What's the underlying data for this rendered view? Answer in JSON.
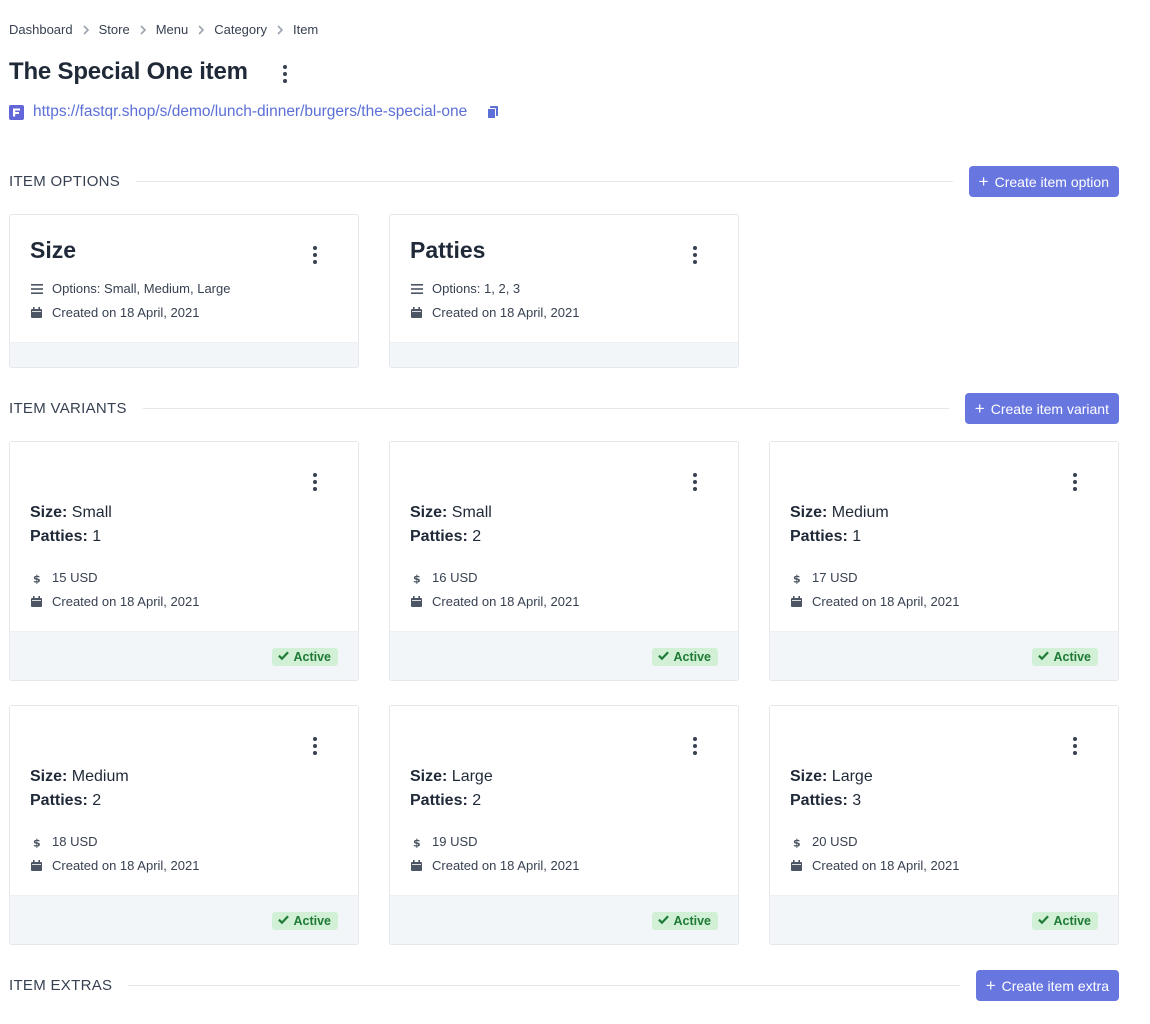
{
  "breadcrumb": [
    "Dashboard",
    "Store",
    "Menu",
    "Category",
    "Item"
  ],
  "page": {
    "title": "The Special One item",
    "url": "https://fastqr.shop/s/demo/lunch-dinner/burgers/the-special-one"
  },
  "options_section": {
    "title": "ITEM OPTIONS",
    "button_label": "Create item option",
    "cards": [
      {
        "title": "Size",
        "options": "Options: Small, Medium, Large",
        "created": "Created on 18 April, 2021"
      },
      {
        "title": "Patties",
        "options": "Options: 1, 2, 3",
        "created": "Created on 18 April, 2021"
      }
    ]
  },
  "variants_section": {
    "title": "ITEM VARIANTS",
    "button_label": "Create item variant",
    "size_label": "Size:",
    "patties_label": "Patties:",
    "cards": [
      {
        "size": "Small",
        "patties": "1",
        "price": "15 USD",
        "created": "Created on 18 April, 2021",
        "status": "Active"
      },
      {
        "size": "Small",
        "patties": "2",
        "price": "16 USD",
        "created": "Created on 18 April, 2021",
        "status": "Active"
      },
      {
        "size": "Medium",
        "patties": "1",
        "price": "17 USD",
        "created": "Created on 18 April, 2021",
        "status": "Active"
      },
      {
        "size": "Medium",
        "patties": "2",
        "price": "18 USD",
        "created": "Created on 18 April, 2021",
        "status": "Active"
      },
      {
        "size": "Large",
        "patties": "2",
        "price": "19 USD",
        "created": "Created on 18 April, 2021",
        "status": "Active"
      },
      {
        "size": "Large",
        "patties": "3",
        "price": "20 USD",
        "created": "Created on 18 April, 2021",
        "status": "Active"
      }
    ]
  },
  "extras_section": {
    "title": "ITEM EXTRAS",
    "button_label": "Create item extra"
  },
  "colors": {
    "accent": "#6876e0",
    "link": "#5b6fd6",
    "active_badge_bg": "#d1f0d6",
    "active_badge_text": "#1f7a36",
    "card_footer": "#f3f6f9"
  },
  "icons": {
    "breadcrumb_separator": "chevron-right-icon",
    "title_menu": "more-vertical-icon",
    "brand": "fastqr-logo-icon",
    "copy": "copy-icon",
    "options": "list-icon",
    "created": "calendar-icon",
    "price": "dollar-icon",
    "active": "check-icon",
    "add": "plus-icon"
  }
}
